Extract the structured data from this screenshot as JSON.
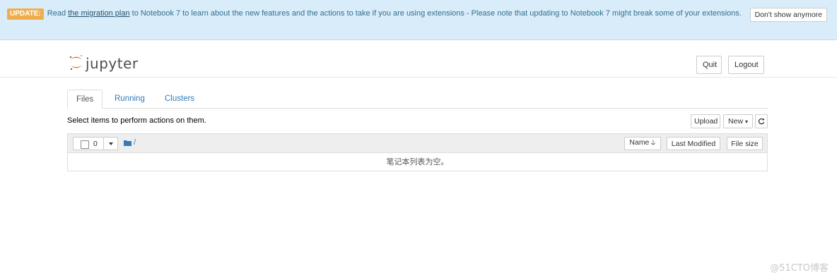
{
  "banner": {
    "badge": "UPDATE:",
    "text_before": "Read ",
    "link": "the migration plan",
    "text_after": " to Notebook 7 to learn about the new features and the actions to take if you are using extensions - Please note that updating to Notebook 7 might break some of your extensions.",
    "dismiss_label": "Don't show anymore"
  },
  "header": {
    "logo_text": "jupyter",
    "quit_label": "Quit",
    "logout_label": "Logout"
  },
  "tabs": [
    {
      "label": "Files",
      "active": true
    },
    {
      "label": "Running",
      "active": false
    },
    {
      "label": "Clusters",
      "active": false
    }
  ],
  "toolbar": {
    "hint": "Select items to perform actions on them.",
    "upload_label": "Upload",
    "new_label": "New",
    "refresh_icon": "refresh-icon"
  },
  "file_list": {
    "selected_count": "0",
    "path": "/",
    "columns": {
      "name": "Name",
      "modified": "Last Modified",
      "size": "File size"
    },
    "empty_message": "笔记本列表为空。"
  },
  "watermark": "@51CTO博客",
  "colors": {
    "banner_bg": "#d9ecf9",
    "badge": "#f0ad4e",
    "link": "#337ab7",
    "logo_orange": "#f37726"
  }
}
